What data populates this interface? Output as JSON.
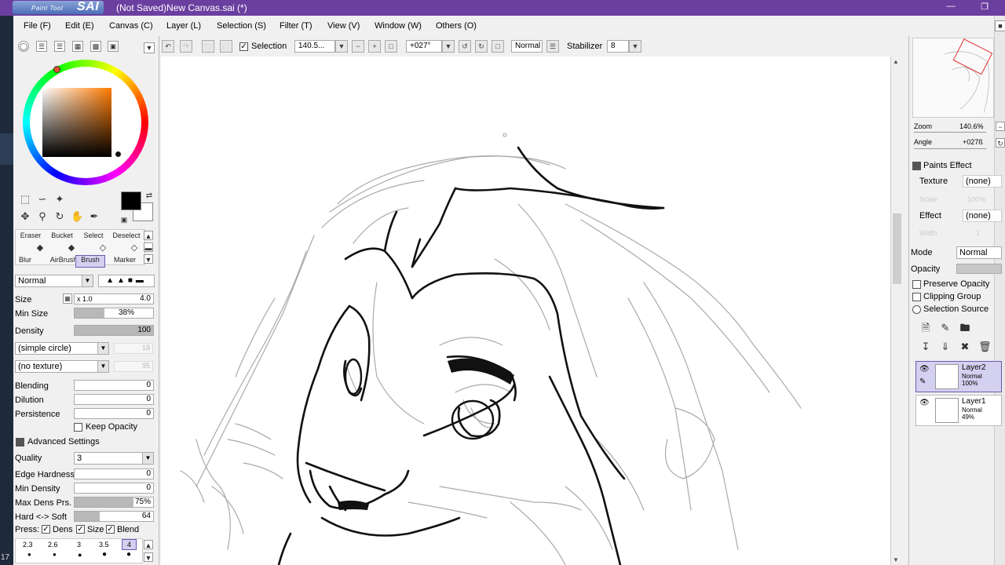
{
  "titlebar": {
    "logo_small": "Paint Tool",
    "logo_big": "SAI",
    "title": "(Not Saved)New Canvas.sai (*)"
  },
  "menus": [
    "File (F)",
    "Edit (E)",
    "Canvas (C)",
    "Layer (L)",
    "Selection (S)",
    "Filter (T)",
    "View (V)",
    "Window (W)",
    "Others (O)"
  ],
  "leftstrip": {
    "number": "17"
  },
  "colors": {
    "foreground": "#000000",
    "background": "#ffffff",
    "accent": "#6b3fa0"
  },
  "brushes": {
    "row1": [
      "Eraser",
      "Bucket",
      "Select",
      "Deselect"
    ],
    "row2": [
      "Blur",
      "AirBrush",
      "Brush",
      "Marker"
    ]
  },
  "brush_settings": {
    "mode": "Normal",
    "size_label": "Size",
    "size_mult": "x 1.0",
    "size_value": "4.0",
    "minsize_label": "Min Size",
    "minsize_value": "38%",
    "minsize_fraction": 0.38,
    "density_label": "Density",
    "density_value": "100",
    "density_fraction": 1.0,
    "shape": "(simple circle)",
    "shape_val": "18",
    "texture": "(no texture)",
    "texture_val": "95",
    "blending_label": "Blending",
    "blending_value": "0",
    "dilution_label": "Dilution",
    "dilution_value": "0",
    "persistence_label": "Persistence",
    "persistence_value": "0",
    "keep_opacity": "Keep Opacity",
    "advanced": "Advanced Settings",
    "quality_label": "Quality",
    "quality_value": "3",
    "edge_label": "Edge Hardness",
    "edge_value": "0",
    "mindens_label": "Min Density",
    "mindens_value": "0",
    "maxdens_label": "Max Dens Prs.",
    "maxdens_value": "75%",
    "maxdens_fraction": 0.75,
    "hardsoft_label": "Hard <-> Soft",
    "hardsoft_value": "64",
    "hardsoft_fraction": 0.32,
    "press_label": "Press:",
    "press_dens": "Dens",
    "press_size": "Size",
    "press_blend": "Blend",
    "sizes": [
      "2.3",
      "2.6",
      "3",
      "3.5",
      "4"
    ]
  },
  "toolbar": {
    "selection_label": "Selection",
    "zoom": "140.5...",
    "angle": "+027°",
    "mode": "Normal",
    "stabilizer_label": "Stabilizer",
    "stabilizer_value": "8"
  },
  "navigator": {
    "zoom_label": "Zoom",
    "zoom_value": "140.6%",
    "angle_label": "Angle",
    "angle_value": "+027ß"
  },
  "paints_effect": {
    "header": "Paints Effect",
    "texture_label": "Texture",
    "texture_value": "(none)",
    "scale_label": "Scale",
    "scale_value": "100%",
    "effect_label": "Effect",
    "effect_value": "(none)",
    "width_label": "Width",
    "width_value": "1"
  },
  "layer_props": {
    "mode_label": "Mode",
    "mode_value": "Normal",
    "opacity_label": "Opacity",
    "preserve": "Preserve Opacity",
    "clipping": "Clipping Group",
    "selection_source": "Selection Source"
  },
  "layers": [
    {
      "name": "Layer2",
      "mode": "Normal",
      "opacity": "100%",
      "active": true
    },
    {
      "name": "Layer1",
      "mode": "Normal",
      "opacity": "49%",
      "active": false
    }
  ]
}
